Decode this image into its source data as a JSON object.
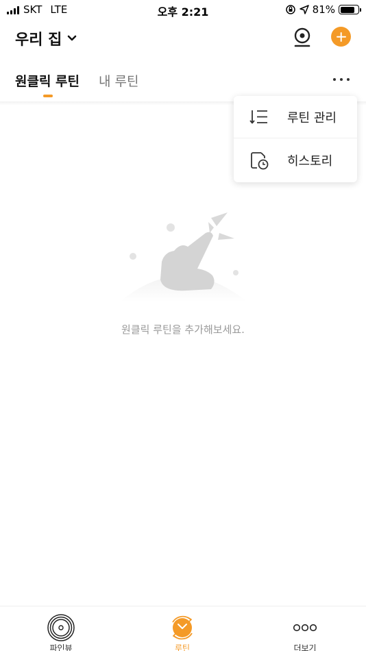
{
  "status_bar": {
    "carrier": "SKT",
    "network": "LTE",
    "time": "오후 2:21",
    "battery": "81%",
    "battery_level": 0.81
  },
  "header": {
    "home_name": "우리 집",
    "icons": [
      "chevron-down-icon",
      "camera-icon",
      "add-icon"
    ]
  },
  "tabs": [
    {
      "label": "원클릭 루틴",
      "active": true
    },
    {
      "label": "내 루틴",
      "active": false
    }
  ],
  "menu": {
    "items": [
      {
        "label": "루틴 관리",
        "icon": "sort-list-icon"
      },
      {
        "label": "히스토리",
        "icon": "history-icon"
      }
    ]
  },
  "empty_state": {
    "message": "원클릭 루틴을 추가해보세요.",
    "illustration": "tap-hand-icon"
  },
  "bottom_nav": {
    "items": [
      {
        "label": "파인뷰",
        "icon": "finview-icon",
        "active": false
      },
      {
        "label": "루틴",
        "icon": "routine-icon",
        "active": true
      },
      {
        "label": "더보기",
        "icon": "more-icon",
        "active": false
      }
    ]
  },
  "colors": {
    "accent": "#f49a27",
    "text_primary": "#111111",
    "text_secondary": "#777777",
    "empty_text": "#999999"
  }
}
